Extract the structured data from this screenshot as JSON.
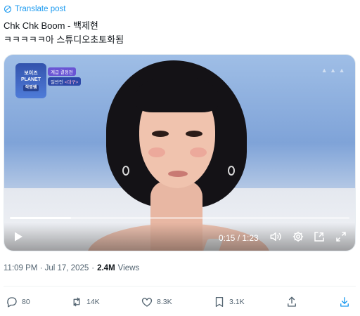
{
  "post": {
    "translate_label": "Translate post",
    "text_line1": "Chk Chk Boom - 백제현",
    "text_line2": "ㅋㅋㅋㅋㅋ아 스튜디오초토화됨"
  },
  "video": {
    "show_logo_line1": "보이즈",
    "show_logo_line2": "PLANET",
    "show_logo_sub": "작명쌤",
    "caption_tag_top": "계급 결정전",
    "caption_tag_name": "일반인",
    "caption_tag_team": "<대구>",
    "current_time": "0:15",
    "duration": "1:23",
    "time_display": "0:15 / 1:23",
    "progress_fraction": 0.18,
    "icons": [
      "play-icon",
      "volume-icon",
      "settings-icon",
      "picture-in-picture-icon",
      "fullscreen-icon"
    ]
  },
  "meta": {
    "timestamp": "11:09 PM · Jul 17, 2025",
    "separator": "·",
    "views_count": "2.4M",
    "views_label": "Views"
  },
  "actions": {
    "reply_count": "80",
    "repost_count": "14K",
    "like_count": "8.3K",
    "bookmark_count": "3.1K"
  },
  "colors": {
    "accent": "#1d9bf0",
    "secondary_text": "#536471",
    "primary_text": "#0f1419"
  }
}
